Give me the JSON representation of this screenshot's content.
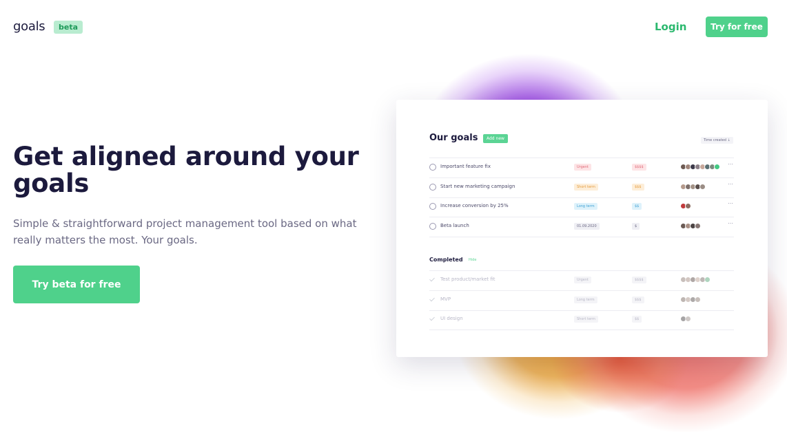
{
  "nav": {
    "logo": "goals",
    "badge": "beta",
    "login": "Login",
    "cta": "Try for free"
  },
  "hero": {
    "title": "Get aligned around your goals",
    "subtitle": "Simple & straightforward project management tool based on what really matters the most. Your goals.",
    "cta": "Try beta for free"
  },
  "card": {
    "title": "Our goals",
    "add_label": "Add new",
    "sort_label": "Time created ↓",
    "more_icon": "⋯",
    "goals": [
      {
        "name": "Important feature fix",
        "tag": "Urgent",
        "tag_color": "#fde4e6",
        "tag_text": "#e06a76",
        "price": "$$$$",
        "price_color": "#fde4e6",
        "price_text": "#e06a76",
        "people": [
          "#6d5a52",
          "#a0857a",
          "#3d3a4a",
          "#8a7e86",
          "#c8a89b",
          "#5a6f73",
          "#7b8a7d",
          "#44c983"
        ]
      },
      {
        "name": "Start new marketing campaign",
        "tag": "Short term",
        "tag_color": "#fdeed9",
        "tag_text": "#e49a3b",
        "price": "$$$",
        "price_color": "#fdeed9",
        "price_text": "#e49a3b",
        "people": [
          "#b59a8c",
          "#7d6e69",
          "#a49387",
          "#594d4a",
          "#9b8d85"
        ]
      },
      {
        "name": "Increase conversion by 25%",
        "tag": "Long term",
        "tag_color": "#def2fb",
        "tag_text": "#3ea1d4",
        "price": "$$",
        "price_color": "#def2fb",
        "price_text": "#3ea1d4",
        "people": [
          "#c0393b",
          "#8b6c60"
        ]
      },
      {
        "name": "Beta launch",
        "tag": "01.09.2020",
        "tag_color": "#efeff4",
        "tag_text": "#6a6883",
        "price": "$",
        "price_color": "#efeff4",
        "price_text": "#6a6883",
        "people": [
          "#6b5b55",
          "#a98f84",
          "#4c4444",
          "#867673"
        ]
      }
    ],
    "completed_title": "Completed",
    "hide_label": "Hide",
    "completed": [
      {
        "name": "Test product/market fit",
        "tag": "Urgent",
        "price": "$$$$",
        "people": [
          "#9c8b84",
          "#b09b92",
          "#6e605c",
          "#c5aea3",
          "#8b7f7b",
          "#6fb38c"
        ]
      },
      {
        "name": "MVP",
        "tag": "Long term",
        "price": "$$$",
        "people": [
          "#8a7b75",
          "#b3a096",
          "#6b6362",
          "#9a8c84"
        ]
      },
      {
        "name": "UI design",
        "tag": "Short term",
        "price": "$$",
        "people": [
          "#5f5a5d",
          "#a79c98"
        ]
      }
    ]
  }
}
